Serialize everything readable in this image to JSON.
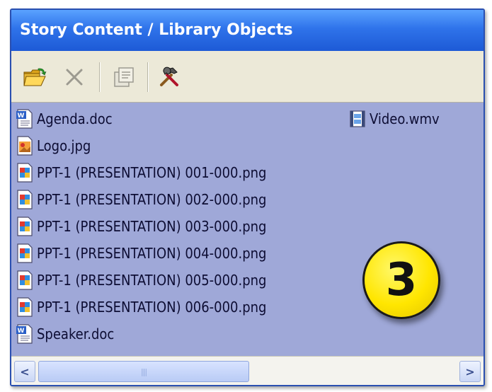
{
  "panel": {
    "title": "Story Content / Library Objects"
  },
  "toolbar": {
    "buttons": [
      {
        "name": "open-folder",
        "icon": "open-folder-icon",
        "enabled": true
      },
      {
        "name": "delete",
        "icon": "delete-x-icon",
        "enabled": false
      },
      {
        "name": "properties",
        "icon": "properties-icon",
        "enabled": false
      },
      {
        "name": "tools",
        "icon": "hammer-wrench-icon",
        "enabled": true
      }
    ]
  },
  "files": [
    {
      "label": "Agenda.doc",
      "icon": "word-document-icon"
    },
    {
      "label": "Logo.jpg",
      "icon": "jpg-image-icon"
    },
    {
      "label": "PPT-1 (PRESENTATION) 001-000.png",
      "icon": "png-image-icon"
    },
    {
      "label": "PPT-1 (PRESENTATION) 002-000.png",
      "icon": "png-image-icon"
    },
    {
      "label": "PPT-1 (PRESENTATION) 003-000.png",
      "icon": "png-image-icon"
    },
    {
      "label": "PPT-1 (PRESENTATION) 004-000.png",
      "icon": "png-image-icon"
    },
    {
      "label": "PPT-1 (PRESENTATION) 005-000.png",
      "icon": "png-image-icon"
    },
    {
      "label": "PPT-1 (PRESENTATION) 006-000.png",
      "icon": "png-image-icon"
    },
    {
      "label": "Speaker.doc",
      "icon": "word-document-icon"
    },
    {
      "label": "Video.wmv",
      "icon": "video-file-icon"
    }
  ],
  "callout": {
    "number": "3",
    "color": "#ffe600"
  },
  "scrollbar": {
    "left_arrow": "<",
    "right_arrow": ">",
    "thumb_grip": "|||"
  },
  "colors": {
    "title_bar": "#2f73ea",
    "list_background": "#9fa8d8",
    "toolbar_background": "#ece9d8"
  }
}
